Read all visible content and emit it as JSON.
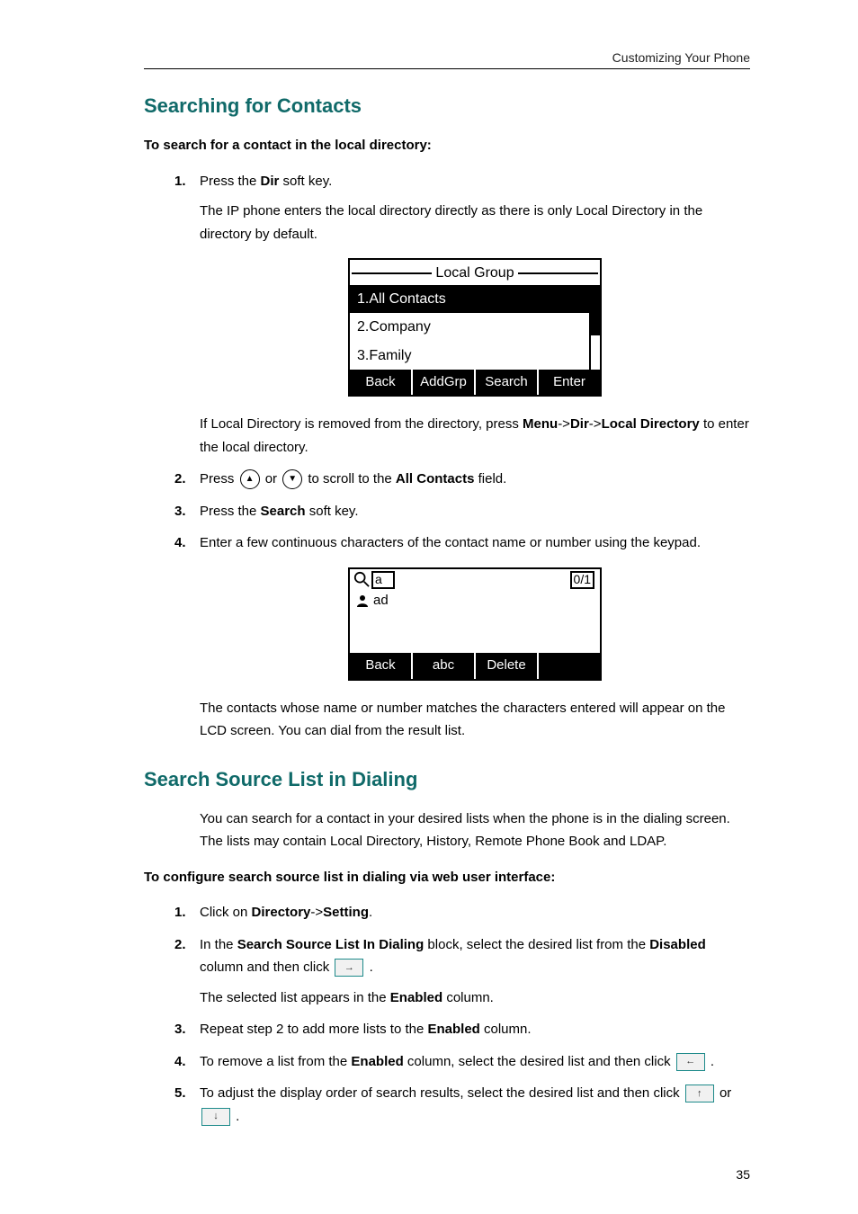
{
  "running_head": "Customizing Your Phone",
  "page_number": "35",
  "section1": {
    "title": "Searching for Contacts",
    "lead": "To search for a contact in the local directory:",
    "step1_a": "Press the ",
    "step1_b": "Dir",
    "step1_c": " soft key.",
    "step1_para": "The IP phone enters the local directory directly as there is only Local Directory in the directory by default.",
    "lcd1": {
      "title": "Local Group",
      "items": [
        "1.All Contacts",
        "2.Company",
        "3.Family"
      ],
      "softkeys": [
        "Back",
        "AddGrp",
        "Search",
        "Enter"
      ]
    },
    "step1_para2_a": "If Local Directory is removed from the directory, press ",
    "step1_para2_b": "Menu",
    "step1_para2_c": "->",
    "step1_para2_d": "Dir",
    "step1_para2_e": "->",
    "step1_para2_f": "Local Directory",
    "step1_para2_g": " to enter the local directory.",
    "step2_a": "Press ",
    "step2_b": " or ",
    "step2_c": " to scroll to the ",
    "step2_d": "All Contacts",
    "step2_e": " field.",
    "step3_a": "Press the ",
    "step3_b": "Search",
    "step3_c": " soft key.",
    "step4": "Enter a few continuous characters of the contact name or number using the keypad.",
    "lcd2": {
      "query": "a",
      "counter": "0/1",
      "result": "ad",
      "softkeys": [
        "Back",
        "abc",
        "Delete",
        ""
      ]
    },
    "step4_para": "The contacts whose name or number matches the characters entered will appear on the LCD screen. You can dial from the result list."
  },
  "section2": {
    "title": "Search Source List in Dialing",
    "intro": "You can search for a contact in your desired lists when the phone is in the dialing screen. The lists may contain Local Directory, History, Remote Phone Book and LDAP.",
    "lead": "To configure search source list in dialing via web user interface:",
    "step1_a": "Click on ",
    "step1_b": "Directory",
    "step1_c": "->",
    "step1_d": "Setting",
    "step1_e": ".",
    "step2_a": "In the ",
    "step2_b": "Search Source List In Dialing",
    "step2_c": " block, select the desired list from the ",
    "step2_d": "Disabled",
    "step2_e": " column and then click ",
    "step2_f": " .",
    "step2_para_a": "The selected list appears in the ",
    "step2_para_b": "Enabled",
    "step2_para_c": " column.",
    "step3_a": "Repeat step 2 to add more lists to the ",
    "step3_b": "Enabled",
    "step3_c": " column.",
    "step4_a": "To remove a list from the ",
    "step4_b": "Enabled",
    "step4_c": " column, select the desired list and then click ",
    "step4_d": " .",
    "step5_a": "To adjust the display order of search results, select the desired list and then click ",
    "step5_b": " or ",
    "step5_c": " ."
  }
}
